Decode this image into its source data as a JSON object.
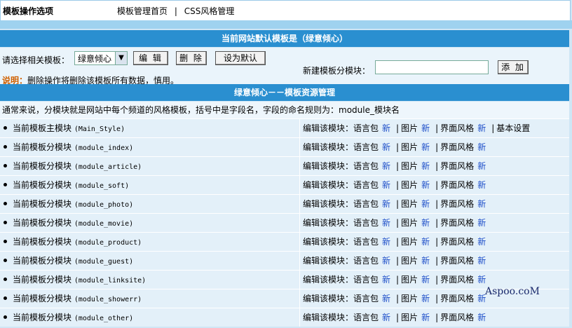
{
  "topbar": {
    "caption": "模板操作选项",
    "link_home": "模板管理首页",
    "separator": "|",
    "link_css": "CSS风格管理"
  },
  "header1": {
    "title": "当前网站默认模板是（绿意倾心）"
  },
  "actions": {
    "select_label": "请选择相关模板：",
    "select_value": "绿意倾心",
    "edit_button": "编 辑",
    "delete_button": "删 除",
    "default_button": "设为默认",
    "note_key": "说明：",
    "note_text": "删除操作将删除该模板所有数据，慎用。",
    "new_label": "新建模板分模块：",
    "add_button": "添 加"
  },
  "header2": {
    "title": "绿意倾心－－模板资源管理"
  },
  "description": "通常来说，分模块就是网站中每个频道的风格模板，括号中是字段名，字段的命名规则为：module_模块名",
  "edit_prefix": "编辑该模块：",
  "op_lang": "语言包",
  "op_pic": "图片",
  "op_style": "界面风格",
  "op_new": "新",
  "op_sep": "|",
  "op_basic": "基本设置",
  "modules": [
    {
      "name": "当前模板主模块",
      "code": "(Main_Style)"
    },
    {
      "name": "当前模板分模块",
      "code": "(module_index)"
    },
    {
      "name": "当前模板分模块",
      "code": "(module_article)"
    },
    {
      "name": "当前模板分模块",
      "code": "(module_soft)"
    },
    {
      "name": "当前模板分模块",
      "code": "(module_photo)"
    },
    {
      "name": "当前模板分模块",
      "code": "(module_movie)"
    },
    {
      "name": "当前模板分模块",
      "code": "(module_product)"
    },
    {
      "name": "当前模板分模块",
      "code": "(module_guest)"
    },
    {
      "name": "当前模板分模块",
      "code": "(module_linksite)"
    },
    {
      "name": "当前模板分模块",
      "code": "(module_showerr)"
    },
    {
      "name": "当前模板分模块",
      "code": "(module_other)"
    }
  ],
  "watermark": "Aspoo.coM"
}
